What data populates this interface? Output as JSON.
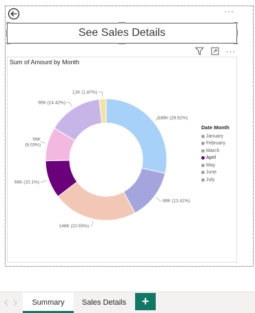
{
  "page": {
    "more_options": "···"
  },
  "button": {
    "label": "See Sales Details"
  },
  "visual": {
    "title": "Sum of Amount by Month",
    "more_options": "···",
    "toolbar_icons": [
      "filter-icon",
      "focus-mode-icon",
      "more-options-icon"
    ]
  },
  "chart_data": {
    "type": "pie",
    "subtype": "donut",
    "title": "Sum of Amount by Month",
    "legend_title": "Date Month",
    "legend_position": "right",
    "legend": [
      {
        "name": "January",
        "color": "#a19f9d"
      },
      {
        "name": "February",
        "color": "#a19f9d"
      },
      {
        "name": "March",
        "color": "#a19f9d"
      },
      {
        "name": "April",
        "color": "#6b007b"
      },
      {
        "name": "May",
        "color": "#a19f9d"
      },
      {
        "name": "June",
        "color": "#a19f9d"
      },
      {
        "name": "July",
        "color": "#a19f9d"
      }
    ],
    "slices": [
      {
        "name": "January",
        "value": 188,
        "percent": 28.62,
        "label": "188K (28.62%)",
        "color": "#a7d1f9"
      },
      {
        "name": "February",
        "value": 88,
        "percent": 13.41,
        "label": "88K (13.41%)",
        "color": "#a4a5dc"
      },
      {
        "name": "March",
        "value": 148,
        "percent": 22.55,
        "label": "148K (22.55%)",
        "color": "#f3c7b5"
      },
      {
        "name": "April",
        "value": 66,
        "percent": 10.1,
        "label": "66K (10.1%)",
        "color": "#6b007b"
      },
      {
        "name": "May",
        "value": 59,
        "percent": 9.03,
        "label_line1": "59K",
        "label_line2": "(9.03%)",
        "color": "#f2b8df"
      },
      {
        "name": "June",
        "value": 95,
        "percent": 14.42,
        "label": "95K (14.42%)",
        "color": "#c8b5e8"
      },
      {
        "name": "July",
        "value": 12,
        "percent": 1.87,
        "label": "12K (1.87%)",
        "color": "#f3e2a0"
      }
    ]
  },
  "tabs": {
    "items": [
      {
        "label": "Summary",
        "active": true
      },
      {
        "label": "Sales Details",
        "active": false
      }
    ],
    "add_label": "+",
    "accent": "#117865"
  }
}
